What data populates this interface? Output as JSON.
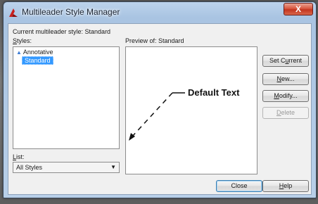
{
  "window": {
    "title": "Multileader Style Manager",
    "close_glyph": "X"
  },
  "current_style": {
    "label": "Current multileader style: Standard"
  },
  "styles": {
    "label_prefix": "",
    "label_access": "S",
    "label_rest": "tyles:",
    "items": [
      {
        "name": "Annotative",
        "annotative": true,
        "selected": false
      },
      {
        "name": "Standard",
        "annotative": false,
        "selected": true
      }
    ]
  },
  "preview": {
    "label": "Preview of: Standard",
    "sample_text": "Default Text"
  },
  "list": {
    "label_access": "L",
    "label_rest": "ist:",
    "selected_value": "All Styles"
  },
  "buttons": {
    "set_current": {
      "pre": "Set C",
      "access": "u",
      "post": "rrent"
    },
    "new": {
      "pre": "",
      "access": "N",
      "post": "ew..."
    },
    "modify": {
      "pre": "",
      "access": "M",
      "post": "odify..."
    },
    "delete": {
      "pre": "",
      "access": "D",
      "post": "elete"
    },
    "close": {
      "label": "Close"
    },
    "help": {
      "pre": "",
      "access": "H",
      "post": "elp"
    }
  },
  "icons": {
    "title_icon": "autocad-icon",
    "annotative_icon": "annotative-triangle-icon",
    "dropdown_icon": "chevron-down-icon"
  },
  "colors": {
    "selection": "#3399ff",
    "close_button": "#c2351f",
    "title_bar": "#a9c4e2"
  }
}
